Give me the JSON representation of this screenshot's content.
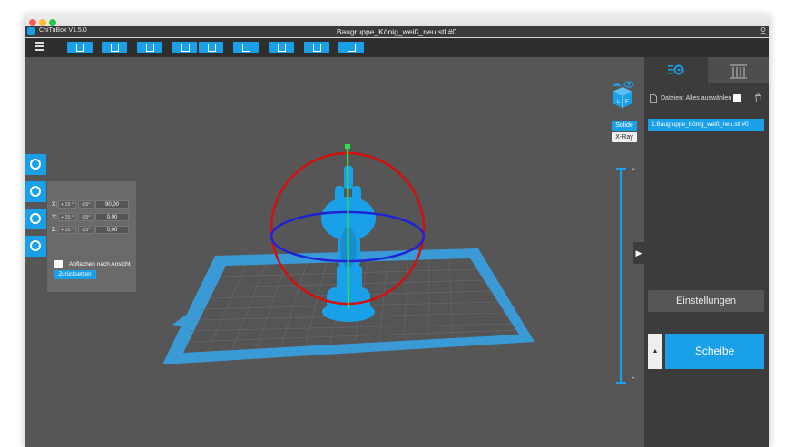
{
  "window": {
    "app_title": "ChiTuBox V1.5.0",
    "document_title": "Baugruppe_König_weiß_neu.stl #0"
  },
  "toolbar": {
    "buttons": [
      "open-file-icon",
      "save-file-icon",
      "select-all-icon",
      "import-icon",
      "export-icon",
      "layout-icon",
      "support-tree-icon",
      "place-on-platform-icon",
      "center-icon"
    ]
  },
  "view_mode": {
    "solid_label": "Solide",
    "xray_label": "X-Ray",
    "selected": "Solide"
  },
  "rotation_panel": {
    "x_label": "X:",
    "y_label": "Y:",
    "z_label": "Z:",
    "plus_step": "+ 15 °",
    "minus_step": "-15°",
    "x_value": "90,00",
    "y_value": "0,00",
    "z_value": "0,00",
    "flatten_label": "Abflachen nach Ansicht",
    "reset_label": "Zurücksetzen"
  },
  "right_panel": {
    "files_label": "Dateien: Alles auswählen",
    "file_items": [
      "1.Baugruppe_König_weiß_neu.stl #0"
    ],
    "settings_label": "Einstellungen",
    "slice_label": "Scheibe"
  },
  "colors": {
    "accent": "#1aa0e8",
    "viewport_bg": "#565656",
    "panel_bg": "#3c3c3c",
    "rotation_ring_x": "#d21010",
    "rotation_ring_z": "#1f22d6",
    "rotation_axis_y": "#2ee04a"
  }
}
